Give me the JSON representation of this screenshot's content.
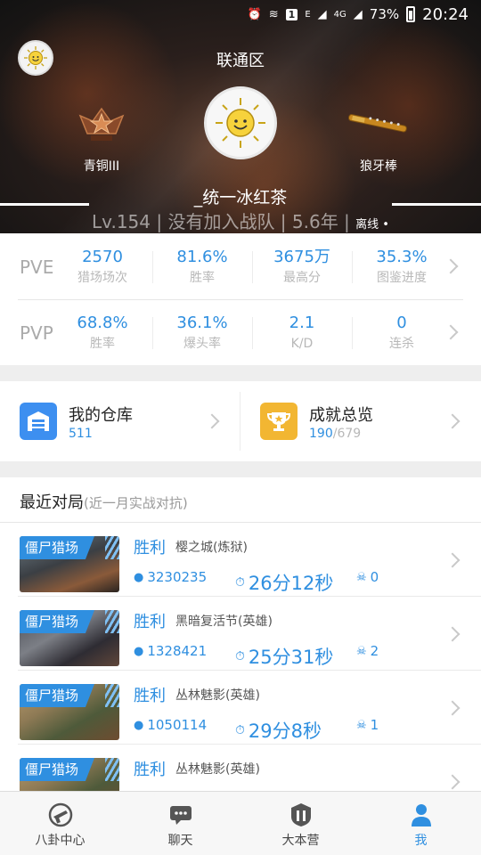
{
  "status_bar": {
    "box_number": "1",
    "signal_e": "E",
    "network": "4G",
    "battery": "73%",
    "time": "20:24"
  },
  "header": {
    "region": "联通区",
    "rank_label": "青铜III",
    "weapon_label": "狼牙棒",
    "player_name": "_统一冰红茶",
    "info_line": "Lv.154 | 没有加入战队 | 5.6年 |",
    "status": "离线 •"
  },
  "stats": {
    "pve": {
      "label": "PVE",
      "items": [
        {
          "value": "2570",
          "label": "猎场场次"
        },
        {
          "value": "81.6%",
          "label": "胜率"
        },
        {
          "value": "3675万",
          "label": "最高分"
        },
        {
          "value": "35.3%",
          "label": "图鉴进度"
        }
      ]
    },
    "pvp": {
      "label": "PVP",
      "items": [
        {
          "value": "68.8%",
          "label": "胜率"
        },
        {
          "value": "36.1%",
          "label": "爆头率"
        },
        {
          "value": "2.1",
          "label": "K/D"
        },
        {
          "value": "0",
          "label": "连杀"
        }
      ]
    }
  },
  "quick": {
    "warehouse": {
      "title": "我的仓库",
      "count": "511"
    },
    "achievements": {
      "title": "成就总览",
      "done": "190",
      "total": "/679"
    }
  },
  "recent": {
    "title": "最近对局",
    "subtitle": "(近一月实战对抗)",
    "matches": [
      {
        "mode": "僵尸猎场",
        "result": "胜利",
        "map": "樱之城(炼狱)",
        "score": "3230235",
        "time": "26分12秒",
        "kills": "0"
      },
      {
        "mode": "僵尸猎场",
        "result": "胜利",
        "map": "黑暗复活节(英雄)",
        "score": "1328421",
        "time": "25分31秒",
        "kills": "2"
      },
      {
        "mode": "僵尸猎场",
        "result": "胜利",
        "map": "丛林魅影(英雄)",
        "score": "1050114",
        "time": "29分8秒",
        "kills": "1"
      },
      {
        "mode": "僵尸猎场",
        "result": "胜利",
        "map": "丛林魅影(英雄)",
        "score": "",
        "time": "",
        "kills": ""
      }
    ]
  },
  "nav": {
    "items": [
      {
        "label": "八卦中心",
        "icon": "gossip-icon"
      },
      {
        "label": "聊天",
        "icon": "chat-icon"
      },
      {
        "label": "大本营",
        "icon": "base-icon"
      },
      {
        "label": "我",
        "icon": "profile-icon"
      }
    ],
    "active_index": 3
  },
  "colors": {
    "accent": "#2f8fe0",
    "achievement_gold": "#f2b632",
    "warehouse_blue": "#3d8ff0"
  }
}
